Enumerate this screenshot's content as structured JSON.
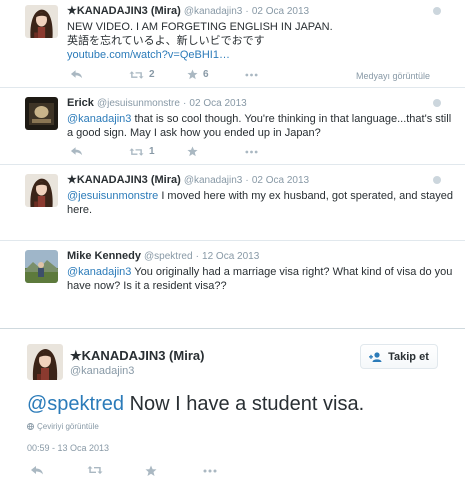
{
  "tweets": [
    {
      "name": "★KANADAJIN3 (Mira)",
      "handle": "@kanadajin3",
      "time": "02 Oca 2013",
      "line1": "NEW VIDEO. I AM FORGETING ENGLISH IN JAPAN.",
      "line2": "英語を忘れているよ、新しいビでおです",
      "link": "youtube.com/watch?v=QeBHI1…",
      "retweets": "2",
      "favorites": "6",
      "media_label": "Medyayı görüntüle"
    },
    {
      "name": "Erick",
      "handle": "@jesuisunmonstre",
      "time": "02 Oca 2013",
      "mention": "@kanadajin3",
      "text": " that is so cool though. You're thinking in that language...that's still a good sign. May I ask how you ended up in Japan?",
      "retweets": "1"
    },
    {
      "name": "★KANADAJIN3 (Mira)",
      "handle": "@kanadajin3",
      "time": "02 Oca 2013",
      "mention": "@jesuisunmonstre",
      "text": " I moved here with my ex husband, got sperated, and stayed here."
    },
    {
      "name": "Mike Kennedy",
      "handle": "@spektred",
      "time": "12 Oca 2013",
      "mention": "@kanadajin3",
      "text": " You originally had a marriage visa right? What kind of visa do you have now?  Is it a resident visa??"
    }
  ],
  "focus": {
    "name": "★KANADAJIN3 (Mira)",
    "handle": "@kanadajin3",
    "follow_label": "Takip et",
    "mention": "@spektred",
    "text": " Now I have a student visa.",
    "translate_label": "Çeviriyi görüntüle",
    "timestamp": "00:59 - 13 Oca 2013"
  },
  "icons": [
    "reply-icon",
    "retweet-icon",
    "favorite-icon",
    "more-icon",
    "follow-icon",
    "globe-icon",
    "settings-icon"
  ],
  "colors": {
    "link": "#2b7bb9",
    "muted": "#8899a6",
    "text": "#292f33",
    "border": "#e1e8ed"
  }
}
